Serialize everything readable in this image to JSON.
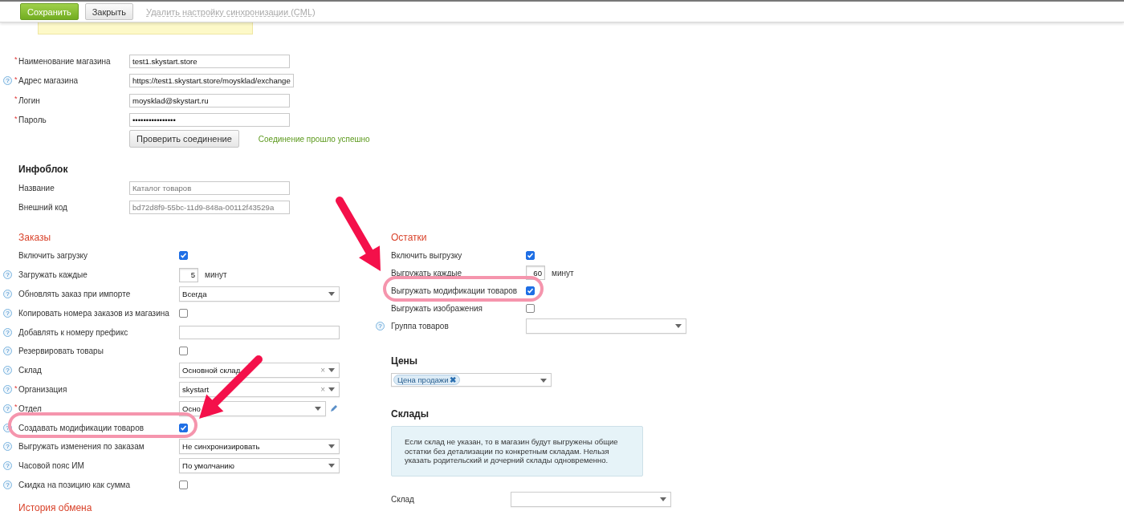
{
  "toolbar": {
    "buttons": [
      {
        "label": "Сохранить",
        "kind": "primary"
      },
      {
        "label": "Закрыть",
        "kind": "default"
      },
      {
        "label": "Удалить настройку синхронизации (CML)",
        "kind": "link"
      }
    ]
  },
  "connection": {
    "fields": [
      {
        "label": "Наименование магазина",
        "required_mark": "*",
        "value": "test1.skystart.store"
      },
      {
        "label": "Адрес магазина",
        "help_icon": "?",
        "required_mark": "*",
        "value": "https://test1.skystart.store/moysklad/exchange"
      },
      {
        "label": "Логин",
        "required_mark": "*",
        "value": "moysklad@skystart.ru"
      },
      {
        "label": "Пароль",
        "required_mark": "*",
        "value": "••••••••••••••••"
      }
    ],
    "test_button": "Проверить соединение",
    "status": "Соединение прошло успешно"
  },
  "infoblock": {
    "title": "Инфоблок",
    "fields": [
      {
        "label": "Название",
        "placeholder": "Каталог товаров"
      },
      {
        "label": "Внешний код",
        "placeholder": "bd72d8f9-55bc-11d9-848a-00112f43529a"
      }
    ]
  },
  "orders": {
    "title": "Заказы",
    "rows": [
      {
        "label": "Включить загрузку",
        "kind": "checkbox",
        "checked": true
      },
      {
        "label": "Загружать каждые",
        "help_icon": "?",
        "kind": "number",
        "value": "5",
        "unit": "минут"
      },
      {
        "label": "Обновлять заказ при импорте",
        "help_icon": "?",
        "kind": "select",
        "value": "Всегда"
      },
      {
        "label": "Копировать номера заказов из магазина",
        "help_icon": "?",
        "kind": "checkbox",
        "checked": false
      },
      {
        "label": "Добавлять к номеру префикс",
        "help_icon": "?",
        "kind": "text"
      },
      {
        "label": "Резервировать товары",
        "help_icon": "?",
        "kind": "checkbox",
        "checked": false
      },
      {
        "label": "Склад",
        "help_icon": "?",
        "kind": "select",
        "value": "Основной склад",
        "clear_icon": "×"
      },
      {
        "label": "Организация",
        "help_icon": "?",
        "required_mark": "*",
        "kind": "select",
        "value": "skystart",
        "clear_icon": "×"
      },
      {
        "label": "Отдел",
        "help_icon": "?",
        "required_mark": "*",
        "kind": "select",
        "value": "Осно",
        "editable": true
      },
      {
        "label": "Создавать модификации товаров",
        "help_icon": "?",
        "kind": "checkbox",
        "checked": true
      },
      {
        "label": "Выгружать изменения по заказам",
        "help_icon": "?",
        "kind": "select",
        "value": "Не синхронизировать"
      },
      {
        "label": "Часовой пояс ИМ",
        "help_icon": "?",
        "kind": "select",
        "value": "По умолчанию"
      },
      {
        "label": "Скидка на позицию как сумма",
        "help_icon": "?",
        "kind": "checkbox",
        "checked": false
      }
    ]
  },
  "history": {
    "title": "История обмена"
  },
  "stock": {
    "title": "Остатки",
    "rows": [
      {
        "label": "Включить выгрузку",
        "kind": "checkbox",
        "checked": true
      },
      {
        "label": "Выгружать каждые",
        "kind": "number",
        "value": "60",
        "unit": "минут"
      },
      {
        "label": "Выгружать модификации товаров",
        "kind": "checkbox",
        "checked": true
      },
      {
        "label": "Выгружать изображения",
        "kind": "checkbox",
        "checked": false
      },
      {
        "label": "Группа товаров",
        "help_icon": "?",
        "kind": "select"
      }
    ]
  },
  "prices": {
    "title": "Цены",
    "tags": [
      {
        "label": "Цена продажи",
        "remove_icon": "✖"
      }
    ]
  },
  "warehouses": {
    "title": "Склады",
    "note": "Если склад не указан, то в магазин будут выгружены общие остатки без детализации по конкретным складам. Нельзя указать родительский и дочерний склады одновременно.",
    "field": {
      "label": "Склад"
    }
  }
}
